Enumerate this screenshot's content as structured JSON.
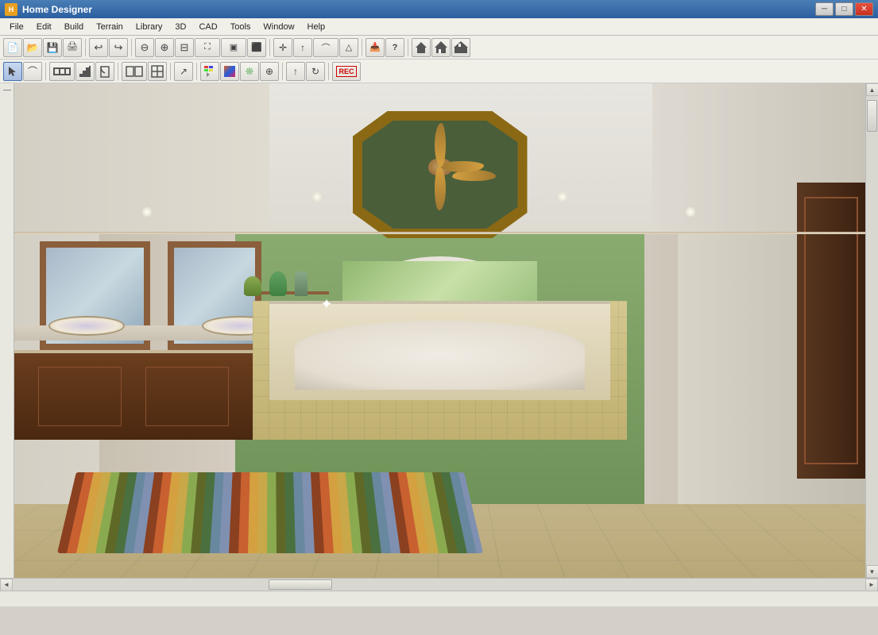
{
  "titleBar": {
    "appName": "Home Designer",
    "icon": "H",
    "controls": {
      "minimize": "─",
      "maximize": "□",
      "close": "✕"
    }
  },
  "menuBar": {
    "items": [
      "File",
      "Edit",
      "Build",
      "Terrain",
      "Library",
      "3D",
      "CAD",
      "Tools",
      "Window",
      "Help"
    ]
  },
  "toolbar1": {
    "buttons": [
      {
        "name": "new",
        "icon": "📄"
      },
      {
        "name": "open",
        "icon": "📂"
      },
      {
        "name": "save",
        "icon": "💾"
      },
      {
        "name": "print",
        "icon": "🖨"
      },
      {
        "name": "undo",
        "icon": "↩"
      },
      {
        "name": "redo",
        "icon": "↪"
      },
      {
        "name": "zoom-out-fit",
        "icon": "⊖"
      },
      {
        "name": "zoom-in",
        "icon": "⊕"
      },
      {
        "name": "zoom-out",
        "icon": "⊟"
      },
      {
        "name": "fill-window",
        "icon": "⛶"
      },
      {
        "name": "resize1",
        "icon": "▣"
      },
      {
        "name": "resize2",
        "icon": "⬛"
      },
      {
        "name": "move-view",
        "icon": "✛"
      },
      {
        "name": "up-arrow",
        "icon": "↑"
      },
      {
        "name": "curve",
        "icon": "⌒"
      },
      {
        "name": "up2",
        "icon": "△"
      },
      {
        "name": "import",
        "icon": "📥"
      },
      {
        "name": "help",
        "icon": "?"
      },
      {
        "name": "house1",
        "icon": "🏠"
      },
      {
        "name": "house2",
        "icon": "🏡"
      },
      {
        "name": "house3",
        "icon": "⌂"
      }
    ]
  },
  "toolbar2": {
    "buttons": [
      {
        "name": "select",
        "icon": "↖",
        "active": true
      },
      {
        "name": "curve2",
        "icon": "⌒"
      },
      {
        "name": "wall",
        "icon": "⊏"
      },
      {
        "name": "door",
        "icon": "▭"
      },
      {
        "name": "stair",
        "icon": "▤"
      },
      {
        "name": "window",
        "icon": "⊞"
      },
      {
        "name": "cabinet",
        "icon": "▬"
      },
      {
        "name": "room",
        "icon": "◫"
      },
      {
        "name": "arrow",
        "icon": "↗"
      },
      {
        "name": "paint",
        "icon": "🖌"
      },
      {
        "name": "material",
        "icon": "▨"
      },
      {
        "name": "plant",
        "icon": "❊"
      },
      {
        "name": "more",
        "icon": "⊕"
      },
      {
        "name": "up-arrow2",
        "icon": "↑"
      },
      {
        "name": "rotate",
        "icon": "↻"
      },
      {
        "name": "record",
        "icon": "⏺"
      }
    ]
  },
  "statusBar": {
    "text": ""
  },
  "scene": {
    "description": "3D bathroom render with ceiling fan, bathtub, vanity, rug"
  }
}
